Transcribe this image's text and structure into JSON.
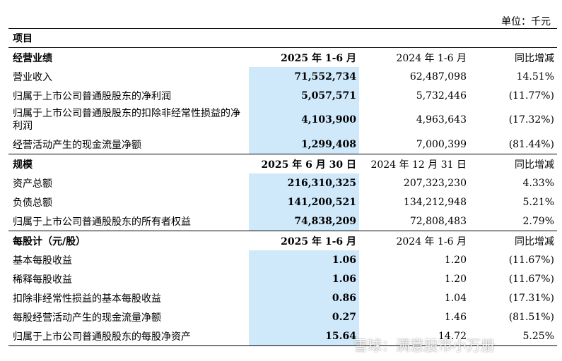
{
  "unit": "单位：千元",
  "project_label": "项目",
  "sections": [
    {
      "title": "经营业绩",
      "cols": [
        "2025 年 1-6 月",
        "2024 年 1-6 月",
        "同比增减"
      ],
      "rows": [
        {
          "label": "营业收入",
          "cur": "71,552,734",
          "prev": "62,487,098",
          "yoy": "14.51%"
        },
        {
          "label": "归属于上市公司普通股股东的净利润",
          "cur": "5,057,571",
          "prev": "5,732,446",
          "yoy": "(11.77%)"
        },
        {
          "label": "归属于上市公司普通股股东的扣除非经常性损益的净利润",
          "cur": "4,103,900",
          "prev": "4,963,643",
          "yoy": "(17.32%)"
        },
        {
          "label": "经营活动产生的现金流量净额",
          "cur": "1,299,408",
          "prev": "7,000,399",
          "yoy": "(81.44%)"
        }
      ]
    },
    {
      "title": "规模",
      "cols": [
        "2025 年 6 月 30 日",
        "2024 年 12 月 31 日",
        "同比增减"
      ],
      "rows": [
        {
          "label": "资产总额",
          "cur": "216,310,325",
          "prev": "207,323,230",
          "yoy": "4.33%"
        },
        {
          "label": "负债总额",
          "cur": "141,200,521",
          "prev": "134,212,948",
          "yoy": "5.21%"
        },
        {
          "label": "归属于上市公司普通股股东的所有者权益",
          "cur": "74,838,209",
          "prev": "72,808,483",
          "yoy": "2.79%"
        }
      ]
    },
    {
      "title": "每股计（元/股）",
      "cols": [
        "2025 年 1-6 月",
        "2024 年 1-6 月",
        "同比增减"
      ],
      "rows": [
        {
          "label": "基本每股收益",
          "cur": "1.06",
          "prev": "1.20",
          "yoy": "(11.67%)"
        },
        {
          "label": "稀释每股收益",
          "cur": "1.06",
          "prev": "1.20",
          "yoy": "(11.67%)"
        },
        {
          "label": "扣除非经常性损益的基本每股收益",
          "cur": "0.86",
          "prev": "1.04",
          "yoy": "(17.31%)"
        },
        {
          "label": "每股经营活动产生的现金流量净额",
          "cur": "0.27",
          "prev": "1.46",
          "yoy": "(81.51%)"
        },
        {
          "label": "归属于上市公司普通股股东的每股净资产",
          "cur": "15.64",
          "prev": "14.72",
          "yoy": "5.25%"
        }
      ]
    }
  ],
  "watermark": "雪球：满意股市小万册"
}
